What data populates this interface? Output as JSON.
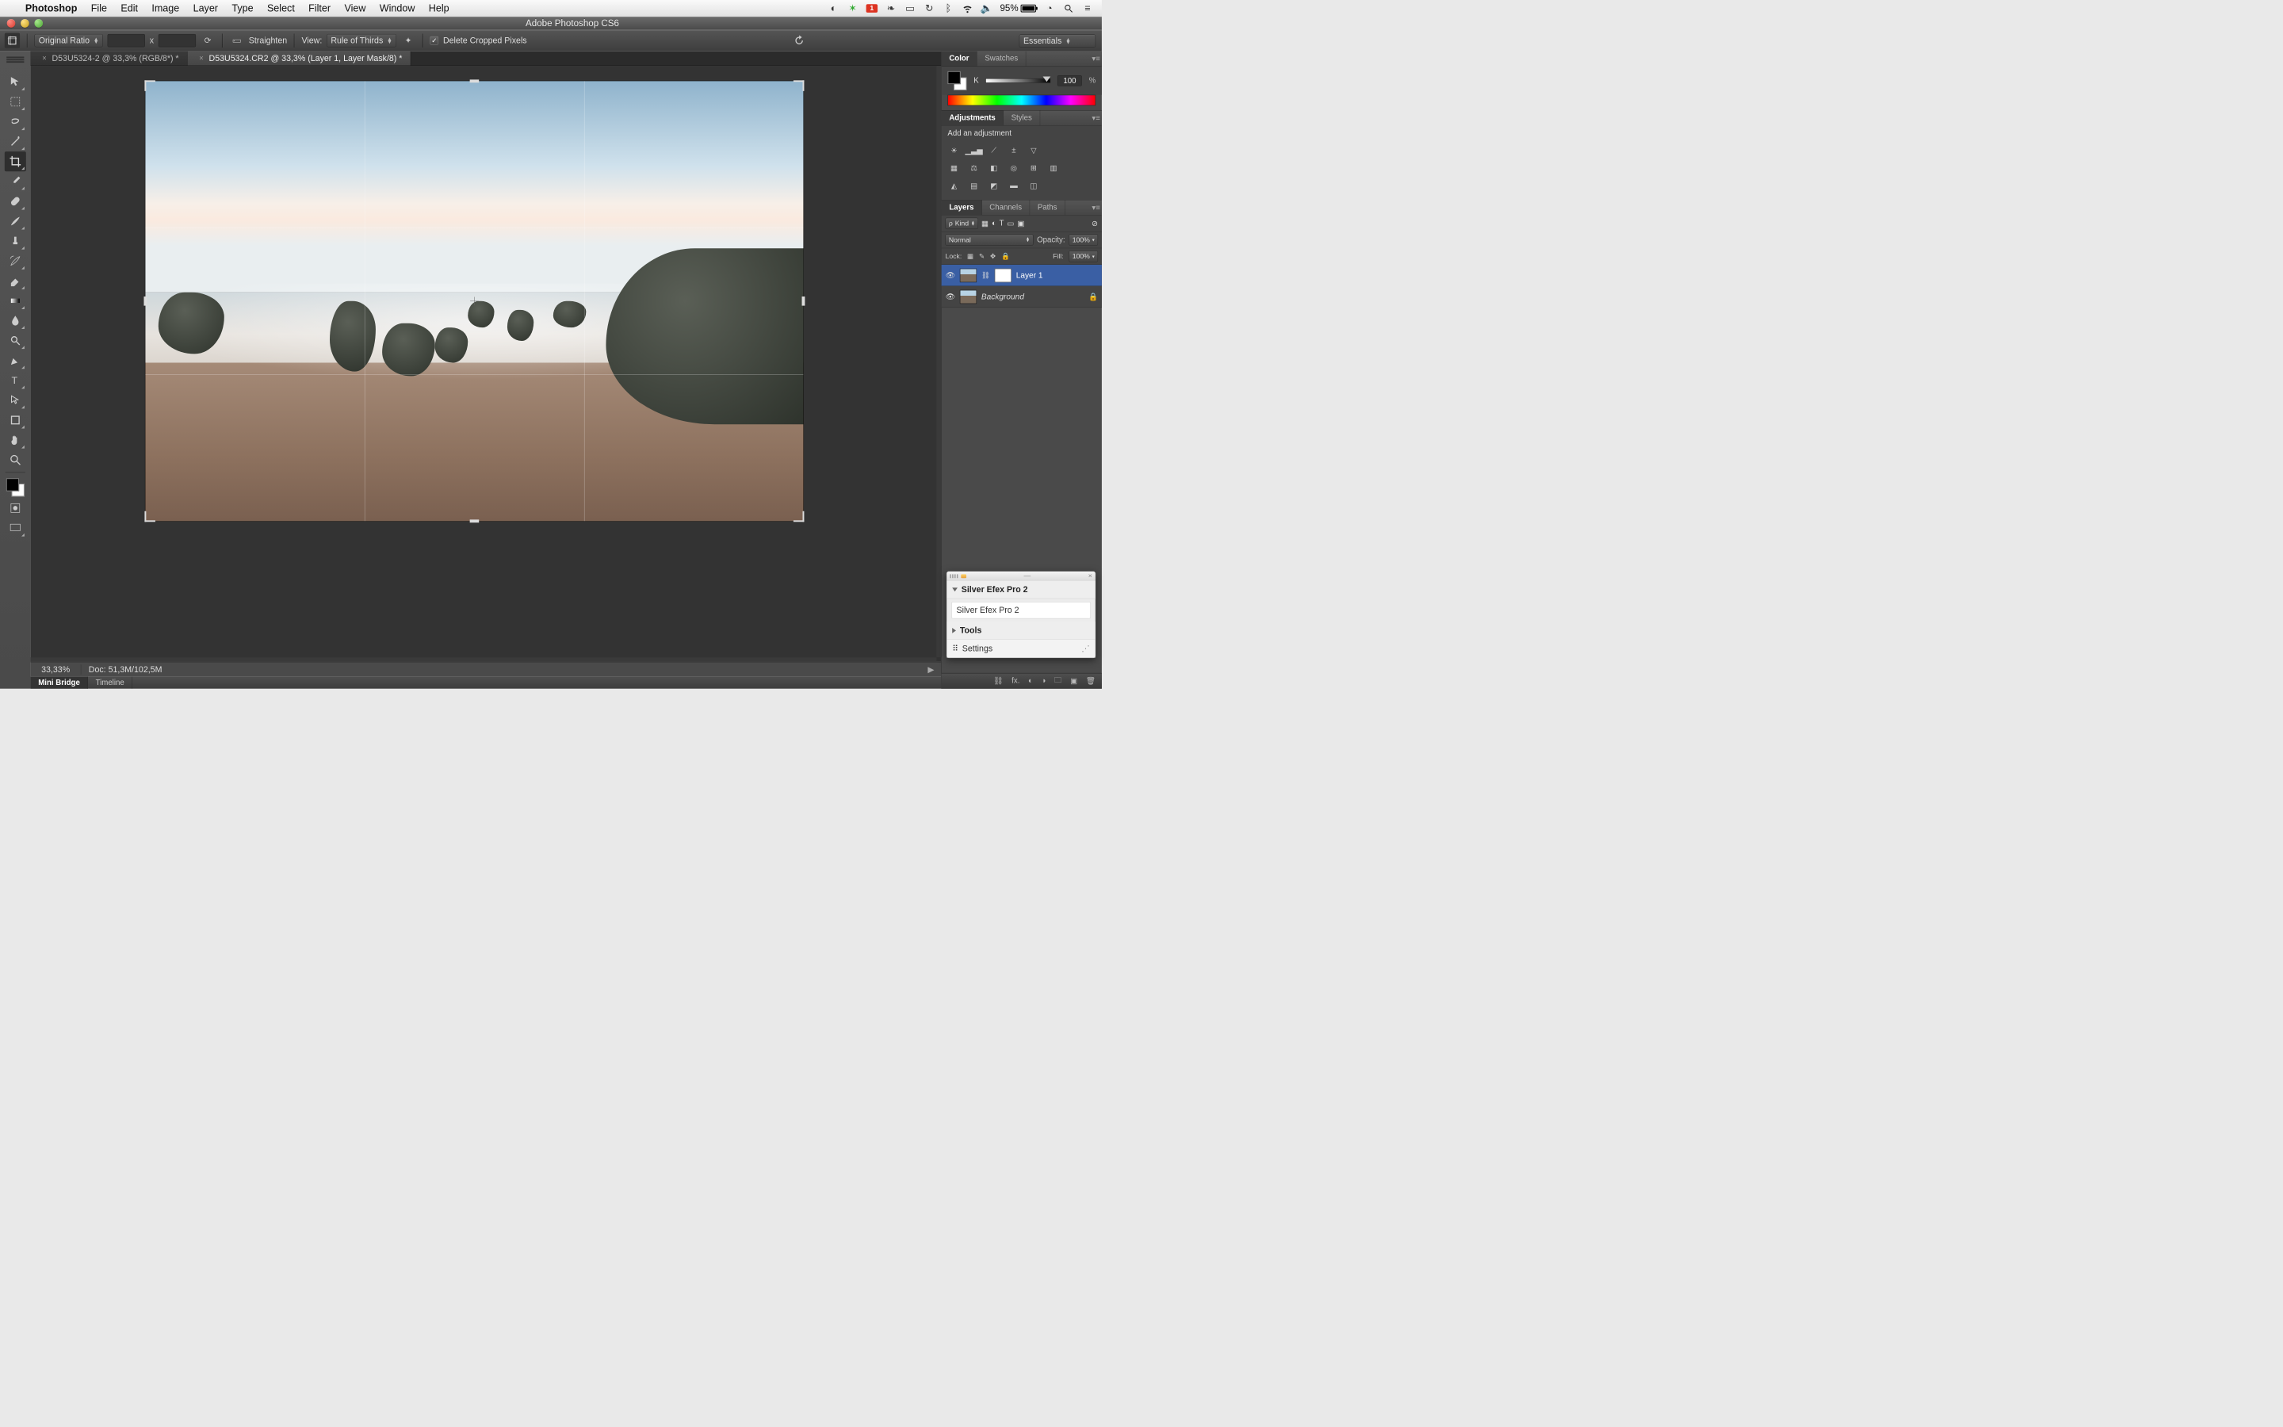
{
  "mac_menu": {
    "app": "Photoshop",
    "items": [
      "File",
      "Edit",
      "Image",
      "Layer",
      "Type",
      "Select",
      "Filter",
      "View",
      "Window",
      "Help"
    ],
    "battery_pct": "95%"
  },
  "titlebar": {
    "title": "Adobe Photoshop CS6"
  },
  "options_bar": {
    "ratio_preset": "Original Ratio",
    "straighten": "Straighten",
    "view_label": "View:",
    "view_mode": "Rule of Thirds",
    "delete_cropped": "Delete Cropped Pixels",
    "workspace": "Essentials"
  },
  "doc_tabs": [
    {
      "label": "D53U5324-2 @ 33,3% (RGB/8*) *",
      "active": false
    },
    {
      "label": "D53U5324.CR2 @ 33,3% (Layer 1, Layer Mask/8) *",
      "active": true
    }
  ],
  "status": {
    "zoom": "33,33%",
    "doc": "Doc: 51,3M/102,5M"
  },
  "bottom_tabs": [
    "Mini Bridge",
    "Timeline"
  ],
  "panels": {
    "color": {
      "tabs": [
        "Color",
        "Swatches"
      ],
      "channel": "K",
      "value": "100",
      "unit": "%"
    },
    "adjustments": {
      "tabs": [
        "Adjustments",
        "Styles"
      ],
      "hint": "Add an adjustment"
    },
    "layers": {
      "tabs": [
        "Layers",
        "Channels",
        "Paths"
      ],
      "kind": "Kind",
      "blend": "Normal",
      "opacity_label": "Opacity:",
      "opacity": "100%",
      "lock_label": "Lock:",
      "fill_label": "Fill:",
      "fill": "100%",
      "items": [
        {
          "name": "Layer 1",
          "has_mask": true,
          "selected": true,
          "locked": false
        },
        {
          "name": "Background",
          "has_mask": false,
          "selected": false,
          "locked": true
        }
      ]
    }
  },
  "float": {
    "title": "Silver Efex Pro 2",
    "entry": "Silver Efex Pro 2",
    "tools": "Tools",
    "settings": "Settings"
  },
  "tools_palette": [
    "move",
    "marquee",
    "lasso",
    "wand",
    "crop",
    "eyedropper",
    "heal",
    "brush",
    "stamp",
    "history",
    "eraser",
    "gradient",
    "blur",
    "dodge",
    "pen",
    "type",
    "path",
    "shape",
    "hand",
    "zoom"
  ]
}
